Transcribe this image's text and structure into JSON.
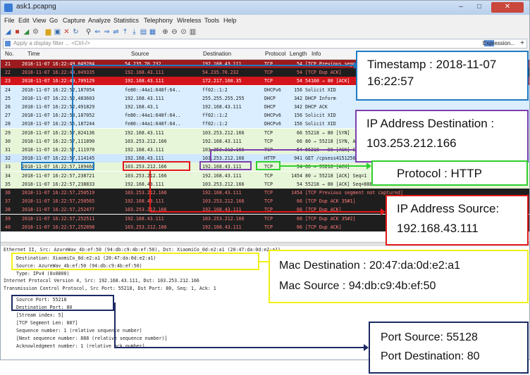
{
  "window": {
    "title": "ask1.pcapng",
    "controls": [
      "–",
      "□",
      "✕"
    ]
  },
  "menu": [
    "File",
    "Edit",
    "View",
    "Go",
    "Capture",
    "Analyze",
    "Statistics",
    "Telephony",
    "Wireless",
    "Tools",
    "Help"
  ],
  "toolbar_icons": [
    "shark-fin-start-icon",
    "stop-icon",
    "restart-icon",
    "options-gear-icon",
    "open-folder-icon",
    "save-icon",
    "close-file-icon",
    "reload-icon",
    "find-icon",
    "back-arrow-icon",
    "forward-arrow-icon",
    "go-to-icon",
    "first-packet-icon",
    "last-packet-icon",
    "autoscroll-icon",
    "colorize-icon",
    "zoom-in-icon",
    "zoom-out-icon",
    "zoom-normal-icon",
    "resize-columns-icon"
  ],
  "filter": {
    "placeholder": "Apply a display filter ... <Ctrl-/>",
    "expression_label": "Expression...",
    "plus": "+"
  },
  "columns": {
    "no": "No.",
    "time": "Time",
    "source": "Source",
    "destination": "Destination",
    "protocol": "Protocol",
    "length": "Length",
    "info": "Info"
  },
  "rows": [
    {
      "no": "21",
      "time": "2018-11-07 16:22:49,049284",
      "src": "54.235.70.232",
      "dst": "192.168.43.111",
      "proto": "TCP",
      "len": "54",
      "info": "[TCP Previous segment not captured]",
      "bg": "#9b1b1e",
      "fg": "#ffffff"
    },
    {
      "no": "22",
      "time": "2018-11-07 16:22:49,049335",
      "src": "192.168.43.111",
      "dst": "54.235.70.232",
      "proto": "TCP",
      "len": "54",
      "info": "[TCP Dup ACK]",
      "bg": "#1e1e1e",
      "fg": "#ff7a7a"
    },
    {
      "no": "23",
      "time": "2018-11-07 16:22:49,709129",
      "src": "192.168.43.111",
      "dst": "172.217.160.35",
      "proto": "TCP",
      "len": "54",
      "info": "54160 → 80 [ACK]",
      "bg": "#d4141c",
      "fg": "#ffffff"
    },
    {
      "no": "24",
      "time": "2018-11-07 16:22:52,187054",
      "src": "fe80::44a1:648f:64..",
      "dst": "ff02::1:2",
      "proto": "DHCPv6",
      "len": "156",
      "info": "Solicit XID",
      "bg": "#daeeff",
      "fg": "#1a1a1a"
    },
    {
      "no": "25",
      "time": "2018-11-07 16:22:52,483603",
      "src": "192.168.43.111",
      "dst": "255.255.255.255",
      "proto": "DHCP",
      "len": "342",
      "info": "DHCP Inform",
      "bg": "#daeeff",
      "fg": "#1a1a1a"
    },
    {
      "no": "26",
      "time": "2018-11-07 16:22:52,491829",
      "src": "192.168.43.1",
      "dst": "192.168.43.111",
      "proto": "DHCP",
      "len": "342",
      "info": "DHCP ACK",
      "bg": "#daeeff",
      "fg": "#1a1a1a"
    },
    {
      "no": "27",
      "time": "2018-11-07 16:22:53,187052",
      "src": "fe80::44a1:648f:64..",
      "dst": "ff02::1:2",
      "proto": "DHCPv6",
      "len": "156",
      "info": "Solicit XID",
      "bg": "#daeeff",
      "fg": "#1a1a1a"
    },
    {
      "no": "28",
      "time": "2018-11-07 16:22:55,187244",
      "src": "fe80::44a1:648f:64..",
      "dst": "ff02::1:2",
      "proto": "DHCPv6",
      "len": "156",
      "info": "Solicit XID",
      "bg": "#daeeff",
      "fg": "#1a1a1a"
    },
    {
      "no": "29",
      "time": "2018-11-07 16:22:57,024136",
      "src": "192.168.43.111",
      "dst": "103.253.212.166",
      "proto": "TCP",
      "len": "66",
      "info": "55218 → 80 [SYN]",
      "bg": "#e7f5d8",
      "fg": "#1a1a1a"
    },
    {
      "no": "30",
      "time": "2018-11-07 16:22:57,111890",
      "src": "103.253.212.166",
      "dst": "192.168.43.111",
      "proto": "TCP",
      "len": "66",
      "info": "80 → 55218 [SYN, ACK]",
      "bg": "#e7f5d8",
      "fg": "#1a1a1a"
    },
    {
      "no": "31",
      "time": "2018-11-07 16:22:57,111970",
      "src": "192.168.43.111",
      "dst": "103.253.212.166",
      "proto": "TCP",
      "len": "54",
      "info": "55218 → 80 [ACK] Seq=1 Ack=1",
      "bg": "#e7f5d8",
      "fg": "#1a1a1a"
    },
    {
      "no": "32",
      "time": "2018-11-07 16:22:57,114145",
      "src": "192.168.43.111",
      "dst": "103.253.212.166",
      "proto": "HTTP",
      "len": "941",
      "info": "GET /cpsess4151256707",
      "bg": "#cfe8ff",
      "fg": "#1a1a1a"
    },
    {
      "no": "33",
      "time": "2018-11-07 16:22:57,189468",
      "src": "103.253.212.166",
      "dst": "192.168.43.111",
      "proto": "TCP",
      "len": "54",
      "info": "80 → 55218 [ACK]",
      "bg": "#e7f5d8",
      "fg": "#1a1a1a"
    },
    {
      "no": "34",
      "time": "2018-11-07 16:22:57,238721",
      "src": "103.253.212.166",
      "dst": "192.168.43.111",
      "proto": "TCP",
      "len": "1454",
      "info": "80 → 55218 [ACK] Seq=1",
      "bg": "#e7f5d8",
      "fg": "#1a1a1a"
    },
    {
      "no": "35",
      "time": "2018-11-07 16:22:57,238833",
      "src": "192.168.43.111",
      "dst": "103.253.212.166",
      "proto": "TCP",
      "len": "54",
      "info": "55218 → 80 [ACK] Seq=888",
      "bg": "#e7f5d8",
      "fg": "#1a1a1a"
    },
    {
      "no": "36",
      "time": "2018-11-07 16:22:57,250519",
      "src": "103.253.212.166",
      "dst": "192.168.43.111",
      "proto": "TCP",
      "len": "1454",
      "info": "[TCP Previous segment not captured]",
      "bg": "#1e1e1e",
      "fg": "#ff7a7a"
    },
    {
      "no": "37",
      "time": "2018-11-07 16:22:57,250565",
      "src": "192.168.43.111",
      "dst": "103.253.212.166",
      "proto": "TCP",
      "len": "66",
      "info": "[TCP Dup ACK 35#1]",
      "bg": "#1e1e1e",
      "fg": "#ff7a7a"
    },
    {
      "no": "38",
      "time": "2018-11-07 16:22:57,252477",
      "src": "103.253.212.166",
      "dst": "192.168.43.111",
      "proto": "TCP",
      "len": "66",
      "info": "[TCP Dup ACK]",
      "bg": "#1e1e1e",
      "fg": "#ff7a7a"
    },
    {
      "no": "39",
      "time": "2018-11-07 16:22:57,252511",
      "src": "192.168.43.111",
      "dst": "103.253.212.166",
      "proto": "TCP",
      "len": "66",
      "info": "[TCP Dup ACK 35#2]",
      "bg": "#1e1e1e",
      "fg": "#ff7a7a"
    },
    {
      "no": "40",
      "time": "2018-11-07 16:22:57,252898",
      "src": "103.253.212.166",
      "dst": "192.168.43.111",
      "proto": "TCP",
      "len": "66",
      "info": "[TCP Dup ACK]",
      "bg": "#1e1e1e",
      "fg": "#ff7a7a"
    }
  ],
  "details": [
    "Ethernet II, Src: AzureWav_4b:ef:50 (94:db:c9:4b:ef:50), Dst: XiaomiCo_0d:e2:a1 (20:47:da:0d:e2:a1)",
    "Destination: XiaomiCo_0d:e2:a1 (20:47:da:0d:e2:a1)",
    "Source: AzureWav_4b:ef:50 (94:db:c9:4b:ef:50)",
    "Type: IPv4 (0x0800)",
    "Internet Protocol Version 4, Src: 192.168.43.111, Dst: 103.253.212.166",
    "Transmission Control Protocol, Src Port: 55218, Dst Port: 80, Seq: 1, Ack: 1",
    "Source Port: 55218",
    "Destination Port: 80",
    "[Stream index: 5]",
    "[TCP Segment Len: 887]",
    "Sequence number: 1    (relative sequence number)",
    "[Next sequence number: 888    (relative sequence number)]",
    "Acknowledgment number: 1    (relative ack number)"
  ],
  "callouts": {
    "timestamp": {
      "line1": "Timestamp : 2018-11-07",
      "line2": "16:22:57"
    },
    "ip_dst": {
      "line1": "IP Address Destination :",
      "line2": "103.253.212.166"
    },
    "protocol": {
      "line1": "Protocol : HTTP"
    },
    "ip_src": {
      "line1": "IP Address Source:",
      "line2": "192.168.43.111"
    },
    "mac": {
      "line1": "Mac Destination : 20:47:da:0d:e2:a1",
      "line2": "Mac Source : 94:db:c9:4b:ef:50"
    },
    "port": {
      "line1": "Port Source: 55128",
      "line2": "Port Destination: 80"
    }
  },
  "colors": {
    "blue": "#1f7bc4",
    "purple": "#7b3fae",
    "green": "#2fd02f",
    "red": "#e01818",
    "yellow": "#f3ef14",
    "navy": "#1b2a63"
  }
}
